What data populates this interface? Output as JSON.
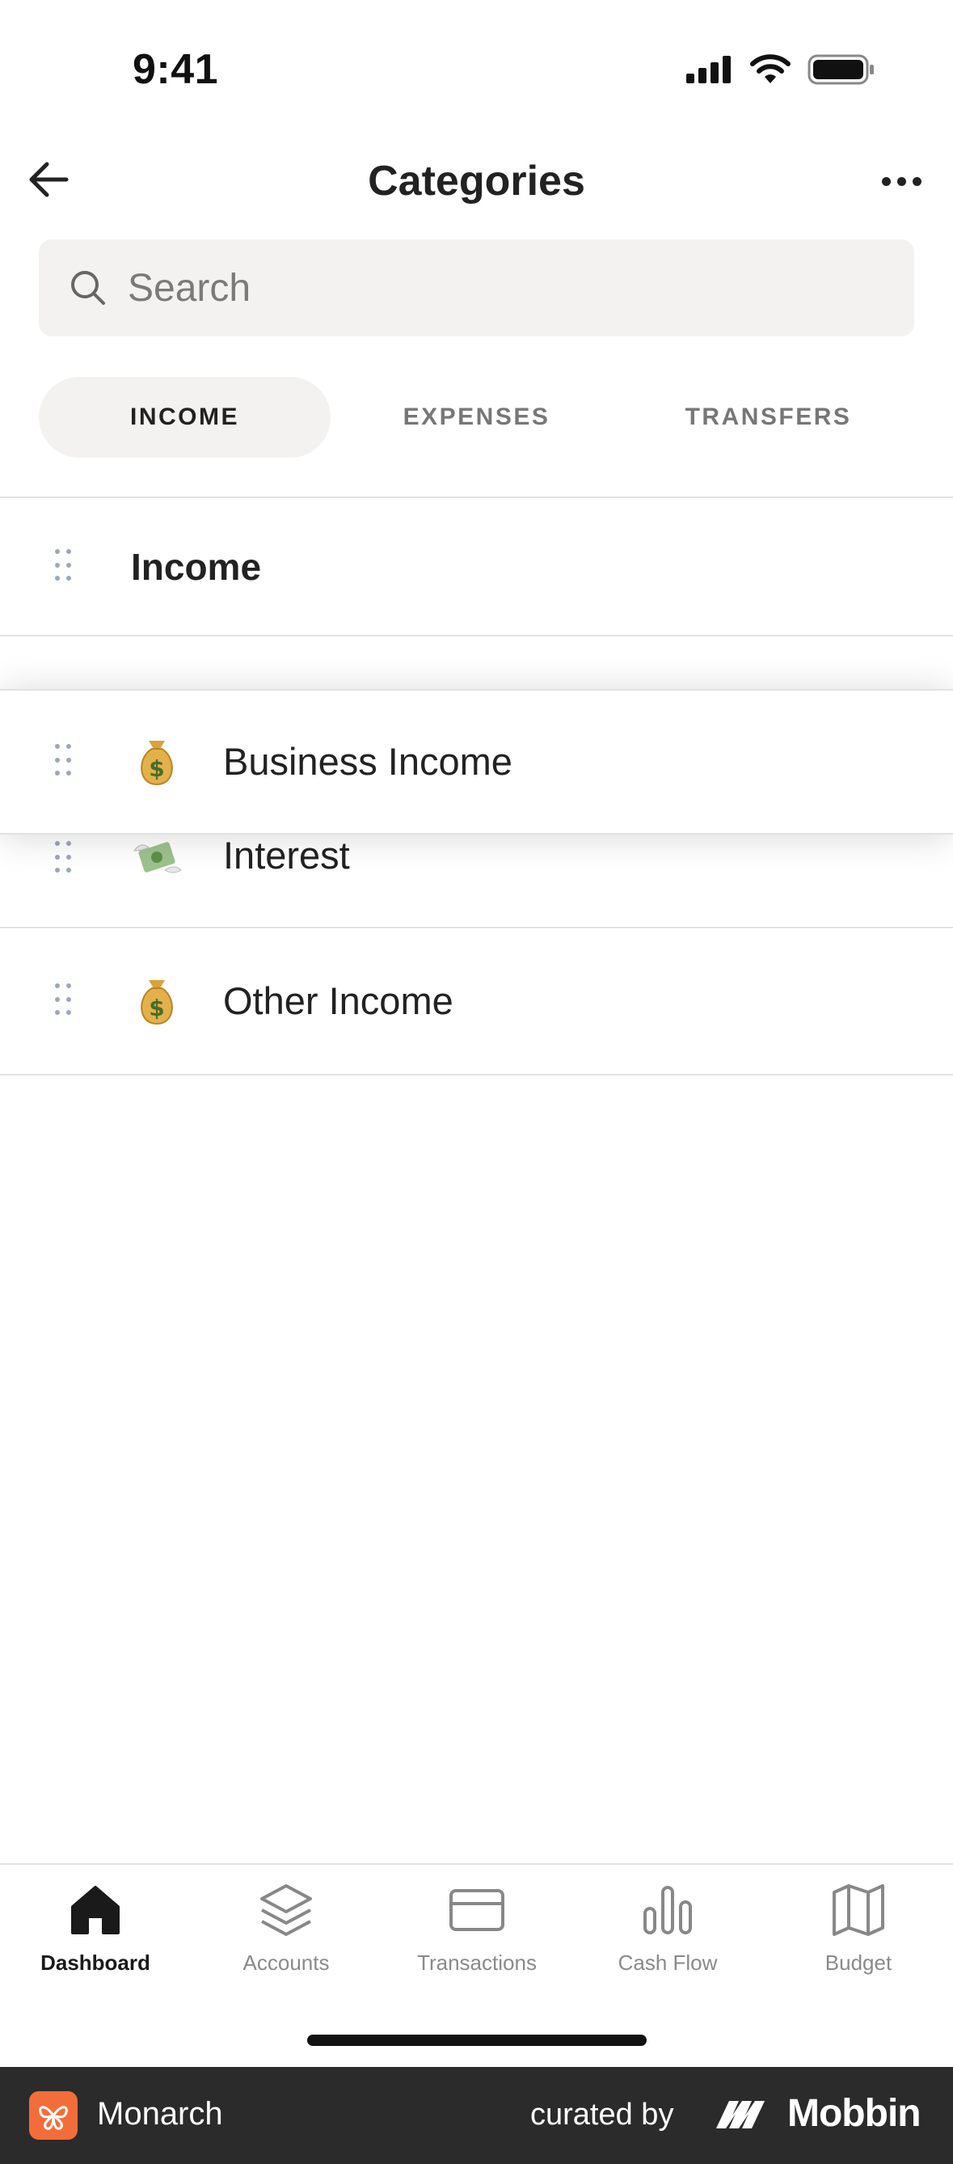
{
  "status_bar": {
    "time": "9:41"
  },
  "header": {
    "title": "Categories"
  },
  "search": {
    "placeholder": "Search"
  },
  "tabs": [
    {
      "label": "INCOME",
      "active": true
    },
    {
      "label": "EXPENSES",
      "active": false
    },
    {
      "label": "TRANSFERS",
      "active": false
    }
  ],
  "list": {
    "group": {
      "label": "Income"
    },
    "dragging_item": {
      "emoji": "money-bag-icon",
      "label": "Business Income"
    },
    "items": [
      {
        "emoji": "money-with-wings-icon",
        "label": "Interest"
      },
      {
        "emoji": "money-bag-icon",
        "label": "Other Income"
      }
    ]
  },
  "tabbar": [
    {
      "label": "Dashboard",
      "icon": "home-icon",
      "active": true
    },
    {
      "label": "Accounts",
      "icon": "layers-icon",
      "active": false
    },
    {
      "label": "Transactions",
      "icon": "credit-card-icon",
      "active": false
    },
    {
      "label": "Cash Flow",
      "icon": "bar-chart-icon",
      "active": false
    },
    {
      "label": "Budget",
      "icon": "map-icon",
      "active": false
    }
  ],
  "footer": {
    "brand": "Monarch",
    "curated_by": "curated by",
    "curator": "Mobbin"
  },
  "colors": {
    "accent_orange": "#f36d3a",
    "tab_active_bg": "#f3f2f0",
    "drag_handle": "#9aa7bf"
  }
}
